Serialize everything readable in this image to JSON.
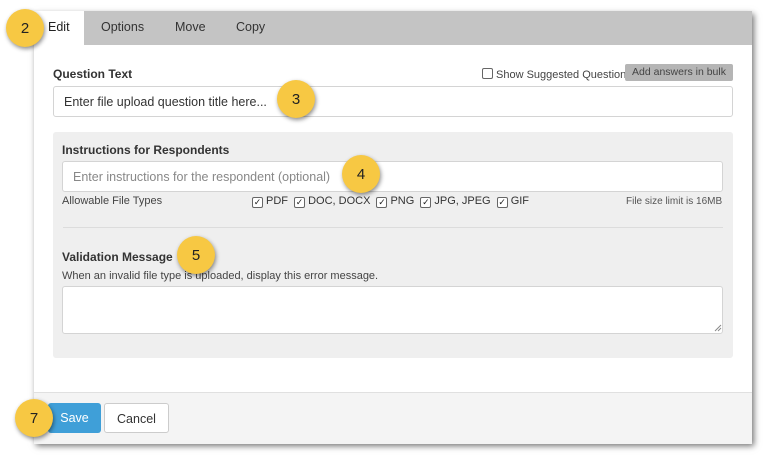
{
  "tabs": [
    {
      "label": "Edit",
      "active": true
    },
    {
      "label": "Options",
      "active": false
    },
    {
      "label": "Move",
      "active": false
    },
    {
      "label": "Copy",
      "active": false
    }
  ],
  "question": {
    "label": "Question Text",
    "value": "Enter file upload question title here...",
    "show_suggested_label": "Show Suggested Questions",
    "show_suggested_checked": false,
    "bulk_button": "Add answers in bulk"
  },
  "instructions": {
    "label": "Instructions for Respondents",
    "placeholder": "Enter instructions for the respondent (optional)"
  },
  "file_types": {
    "label": "Allowable File Types",
    "options": [
      {
        "label": "PDF",
        "checked": true
      },
      {
        "label": "DOC, DOCX",
        "checked": true
      },
      {
        "label": "PNG",
        "checked": true
      },
      {
        "label": "JPG, JPEG",
        "checked": true
      },
      {
        "label": "GIF",
        "checked": true
      }
    ],
    "size_limit": "File size limit is 16MB"
  },
  "validation": {
    "label": "Validation Message",
    "description": "When an invalid file type is uploaded, display this error message.",
    "value": ""
  },
  "footer": {
    "save": "Save",
    "cancel": "Cancel"
  },
  "callouts": [
    "2",
    "3",
    "4",
    "5",
    "7"
  ],
  "colors": {
    "callout": "#f7c843",
    "primary": "#3f9fd8",
    "tabbar": "#c4c4c4"
  }
}
